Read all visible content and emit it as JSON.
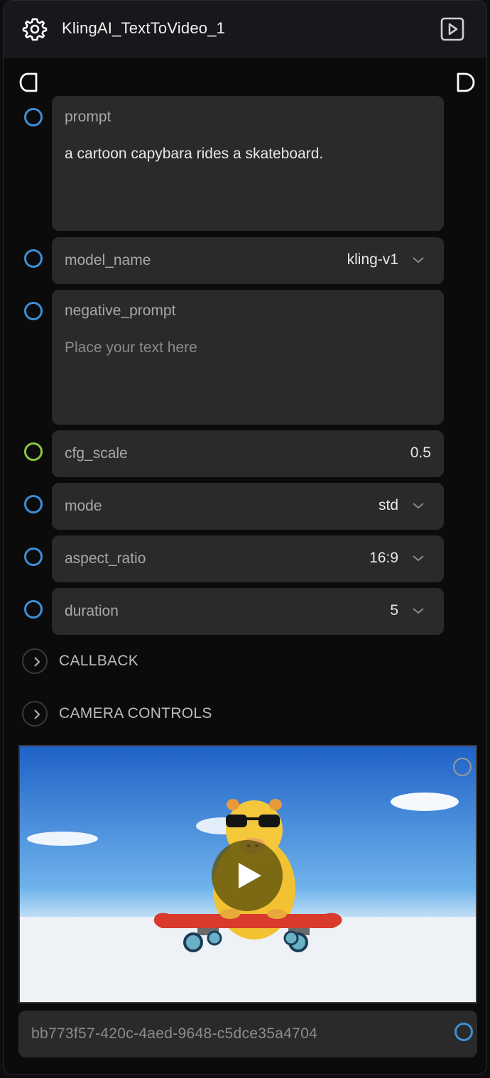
{
  "node": {
    "title": "KlingAI_TextToVideo_1",
    "icons": {
      "settings": "gear-icon",
      "run": "play-square-icon",
      "input_port": "half-rounded-port-icon",
      "output_port": "d-shaped-port-icon"
    }
  },
  "fields": {
    "prompt": {
      "label": "prompt",
      "value": "a cartoon capybara rides a skateboard."
    },
    "model_name": {
      "label": "model_name",
      "value": "kling-v1"
    },
    "negative_prompt": {
      "label": "negative_prompt",
      "placeholder": "Place your text here"
    },
    "cfg_scale": {
      "label": "cfg_scale",
      "value": "0.5"
    },
    "mode": {
      "label": "mode",
      "value": "std"
    },
    "aspect_ratio": {
      "label": "aspect_ratio",
      "value": "16:9"
    },
    "duration": {
      "label": "duration",
      "value": "5"
    }
  },
  "sections": {
    "callback": "CALLBACK",
    "camera_controls": "CAMERA CONTROLS"
  },
  "output": {
    "id": "bb773f57-420c-4aed-9648-c5dce35a4704"
  },
  "colors": {
    "socket_blue": "#3d8fd6",
    "socket_green": "#8cc63f",
    "field_bg": "#2a2a2b",
    "node_bg": "#0b0b0c",
    "header_bg": "#17181b"
  }
}
